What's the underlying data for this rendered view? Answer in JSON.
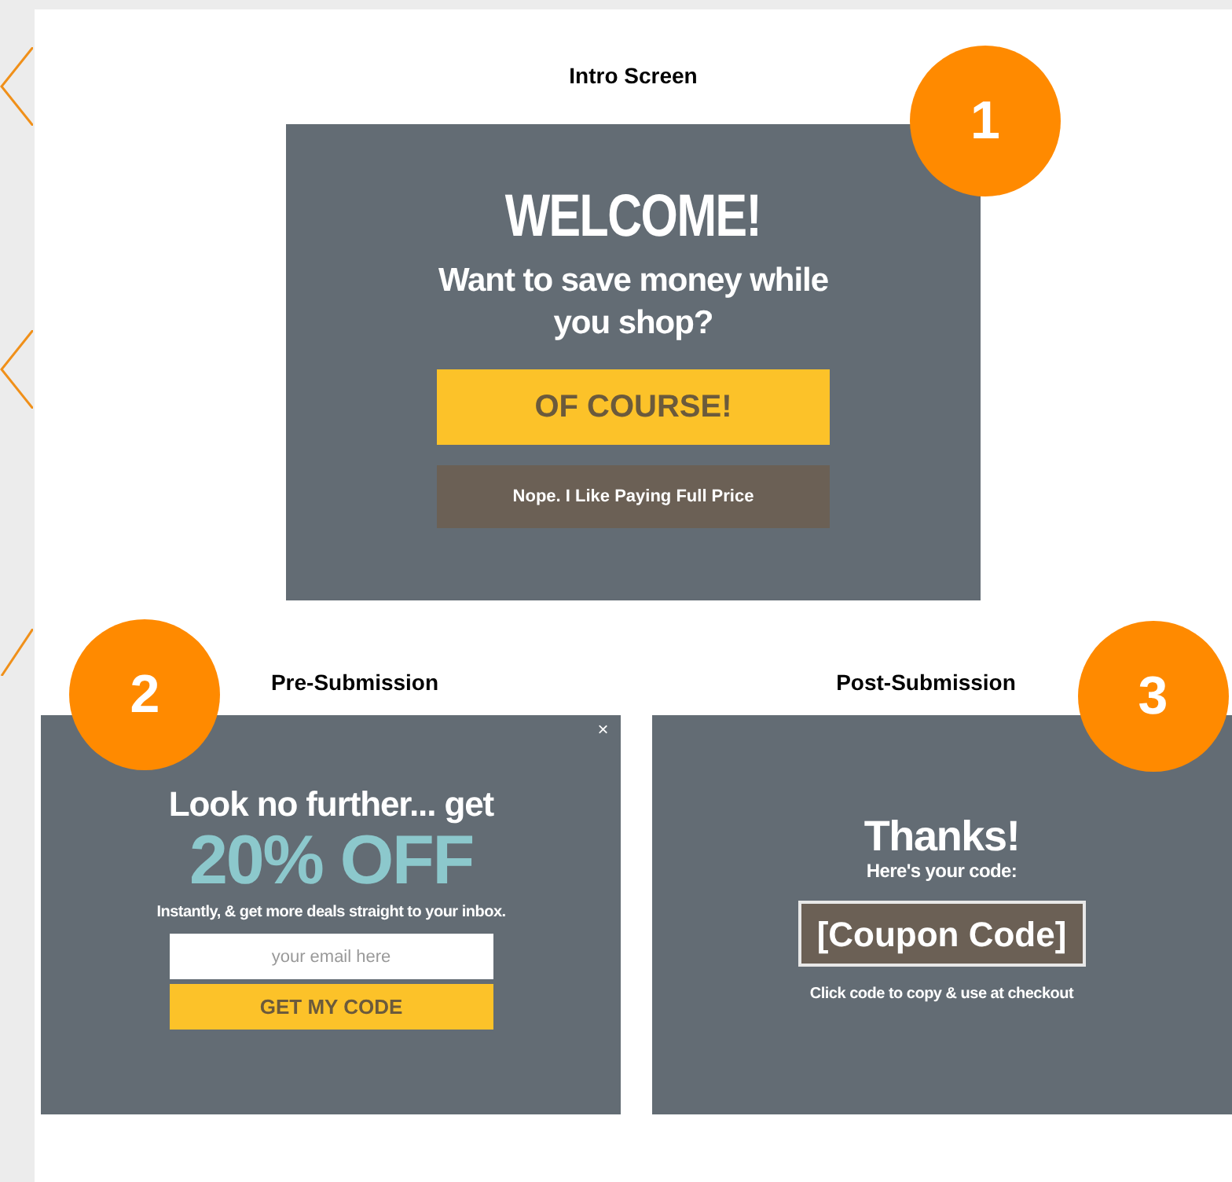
{
  "intro": {
    "title": "Intro Screen",
    "badge": "1",
    "heading": "WELCOME!",
    "subheading": "Want to save money while you shop?",
    "accept_button": "OF COURSE!",
    "decline_button": "Nope. I Like Paying Full Price"
  },
  "pre_submission": {
    "title": "Pre-Submission",
    "badge": "2",
    "close": "×",
    "lead": "Look no further... get",
    "offer": "20% OFF",
    "text": "Instantly, & get more deals straight to your inbox.",
    "email_field": {
      "placeholder": "your email here"
    },
    "submit_button": "GET MY CODE"
  },
  "post_submission": {
    "title": "Post-Submission",
    "badge": "3",
    "heading": "Thanks!",
    "subheading": "Here's your code:",
    "code_button": "[Coupon Code]",
    "note": "Click code to copy & use at checkout"
  }
}
